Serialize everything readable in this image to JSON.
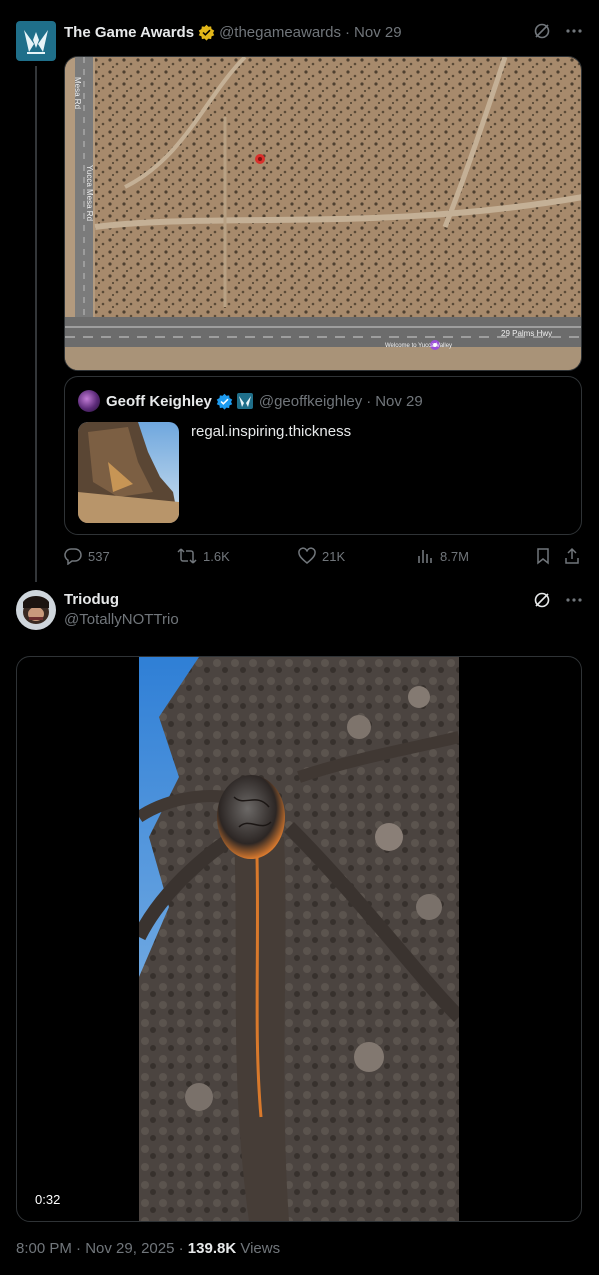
{
  "parent_tweet": {
    "author_name": "The Game Awards",
    "handle": "@thegameawards",
    "separator": "·",
    "date": "Nov 29",
    "media": {
      "road_label_left": "Mesa Rd",
      "road_label_left_2": "Yucca Mesa Rd",
      "road_label_bottom": "29 Palms Hwy",
      "poi_label": "Welcome to\nYucca Valley"
    },
    "quote": {
      "author_name": "Geoff Keighley",
      "handle": "@geoffkeighley",
      "separator": "·",
      "date": "Nov 29",
      "text": "regal.inspiring.thickness"
    },
    "actions": {
      "replies": "537",
      "reposts": "1.6K",
      "likes": "21K",
      "views": "8.7M"
    }
  },
  "main_tweet": {
    "author_name": "Triodug",
    "handle": "@TotallyNOTTrio",
    "video_duration": "0:32",
    "time": "8:00 PM",
    "separator": "·",
    "date": "Nov 29, 2025",
    "views_count": "139.8K",
    "views_label": "Views"
  },
  "icons": {
    "verified_gold": "verified-gold-badge",
    "verified_blue": "verified-blue-badge",
    "affiliate": "game-awards-affiliate-badge",
    "grok": "grok-icon",
    "more": "more-icon",
    "reply": "reply-icon",
    "repost": "repost-icon",
    "like": "heart-icon",
    "views": "views-icon",
    "bookmark": "bookmark-icon",
    "share": "share-icon"
  },
  "colors": {
    "background": "#000000",
    "text": "#e7e9ea",
    "muted": "#71767b",
    "border": "#2f3336",
    "gold_badge": "#e2b719",
    "blue_badge": "#1d9bf0"
  }
}
